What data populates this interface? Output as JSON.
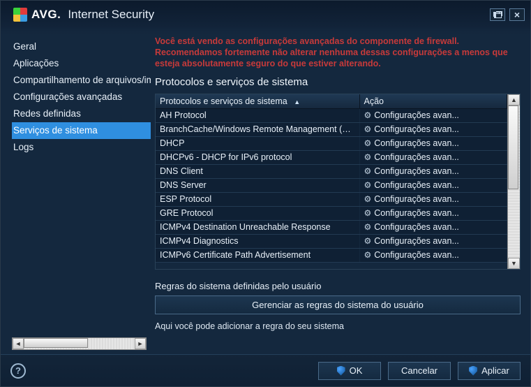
{
  "brand": {
    "avg": "AVG.",
    "product": "Internet Security"
  },
  "sidebar": {
    "items": [
      {
        "label": "Geral"
      },
      {
        "label": "Aplicações"
      },
      {
        "label": "Compartilhamento de arquivos/imp"
      },
      {
        "label": "Configurações avançadas"
      },
      {
        "label": "Redes definidas"
      },
      {
        "label": "Serviços de sistema"
      },
      {
        "label": "Logs"
      }
    ],
    "selected_index": 5
  },
  "main": {
    "warning": "Você está vendo as configurações avançadas do componente de firewall. Recomendamos fortemente não alterar nenhuma dessas configurações a menos que esteja absolutamente seguro do que estiver alterando.",
    "section_title": "Protocolos e serviços de sistema",
    "table": {
      "columns": {
        "protocol": "Protocolos e serviços de sistema",
        "action": "Ação"
      },
      "action_label": "Configurações avan...",
      "rows": [
        "AH Protocol",
        "BranchCache/Windows Remote Management (Com",
        "DHCP",
        "DHCPv6 - DHCP for IPv6 protocol",
        "DNS Client",
        "DNS Server",
        "ESP Protocol",
        "GRE Protocol",
        "ICMPv4 Destination Unreachable Response",
        "ICMPv4 Diagnostics",
        "ICMPv6 Certificate Path Advertisement"
      ]
    },
    "user_rules_label": "Regras do sistema definidas pelo usuário",
    "manage_button": "Gerenciar as regras do sistema do usuário",
    "hint": "Aqui você pode adicionar a regra do seu sistema"
  },
  "footer": {
    "ok": "OK",
    "cancel": "Cancelar",
    "apply": "Aplicar"
  }
}
